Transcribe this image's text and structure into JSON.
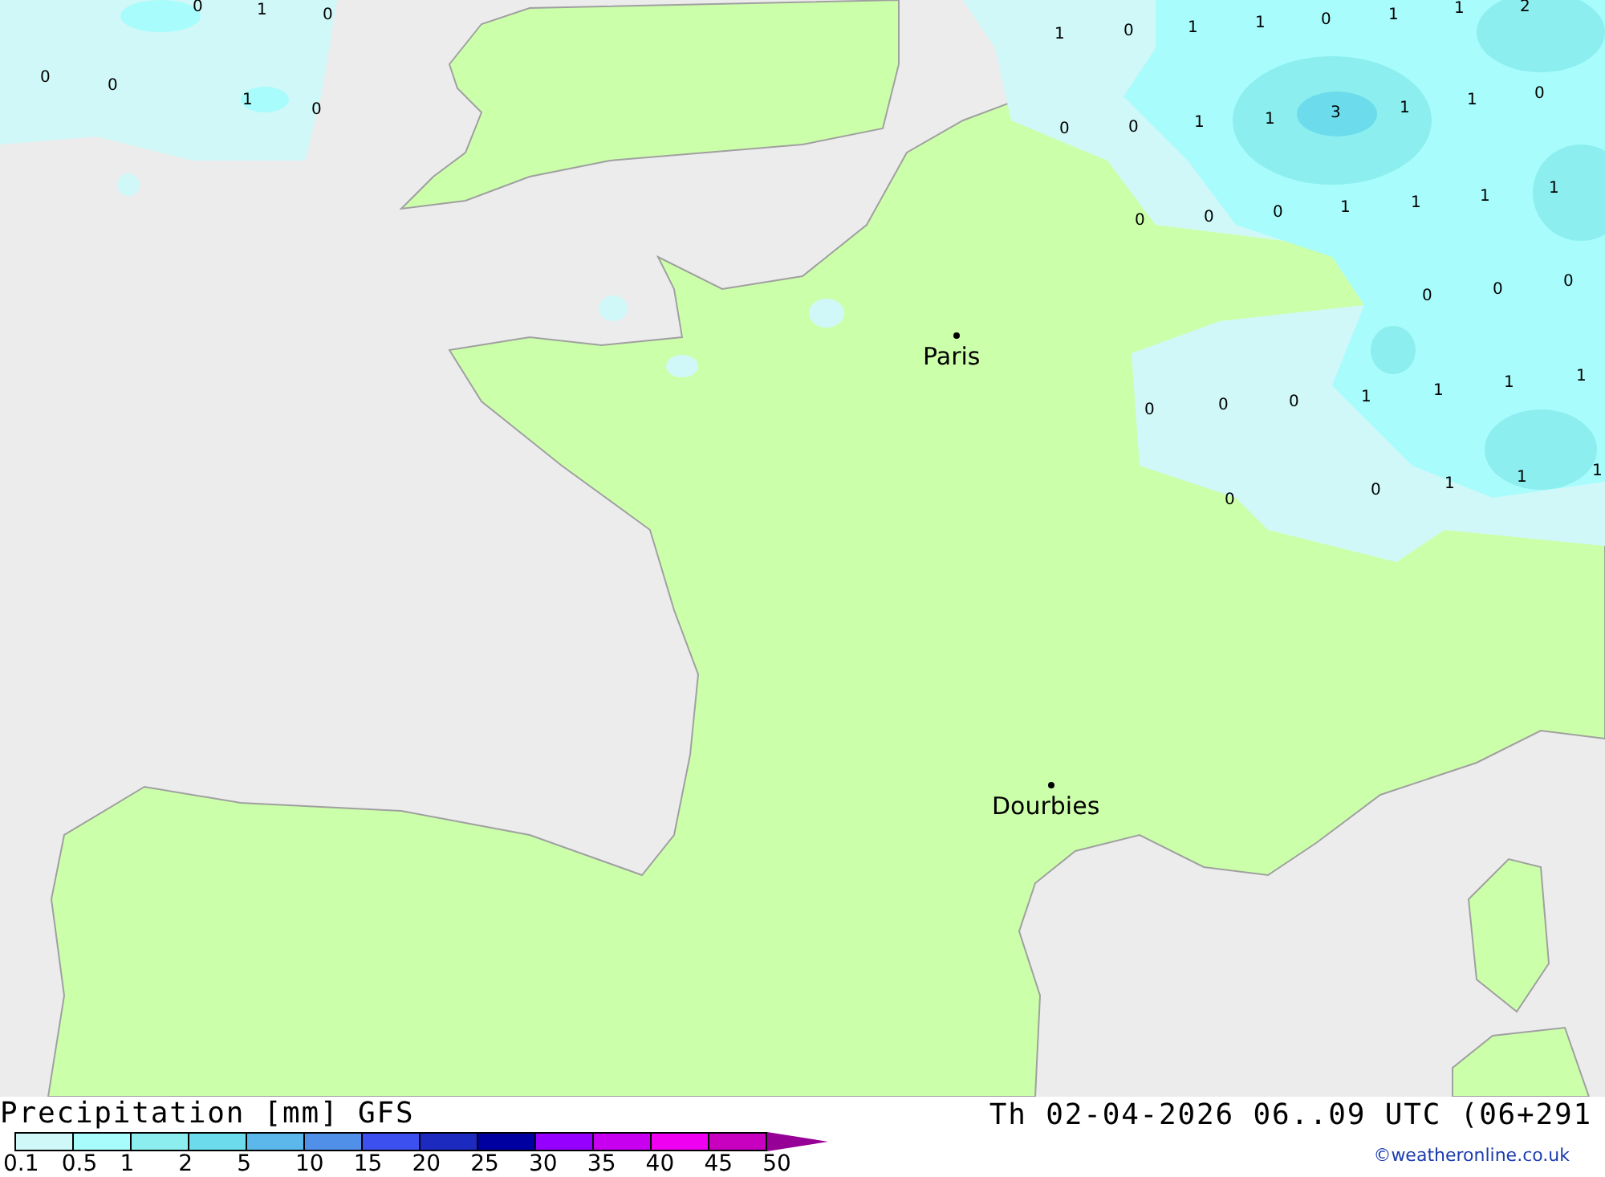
{
  "map": {
    "cities": [
      {
        "name": "Paris"
      },
      {
        "name": "Dourbies"
      }
    ],
    "values": [
      "0",
      "1",
      "0",
      "0",
      "0",
      "1",
      "0",
      "1",
      "0",
      "1",
      "1",
      "0",
      "1",
      "1",
      "2",
      "0",
      "0",
      "1",
      "1",
      "3",
      "1",
      "1",
      "0",
      "0",
      "0",
      "0",
      "1",
      "1",
      "1",
      "1",
      "0",
      "0",
      "0",
      "0",
      "0",
      "0",
      "1",
      "1",
      "1",
      "1",
      "0",
      "0",
      "1",
      "1",
      "1"
    ]
  },
  "legend": {
    "title": "Precipitation [mm] GFS",
    "classes": [
      {
        "label": "0.1",
        "color": "#d0f8f8"
      },
      {
        "label": "0.5",
        "color": "#a8fcfc"
      },
      {
        "label": "1",
        "color": "#8ceeee"
      },
      {
        "label": "2",
        "color": "#6cdcec"
      },
      {
        "label": "5",
        "color": "#5cb8ea"
      },
      {
        "label": "10",
        "color": "#5090e8"
      },
      {
        "label": "15",
        "color": "#3c50f0"
      },
      {
        "label": "20",
        "color": "#1c2ac0"
      },
      {
        "label": "25",
        "color": "#0000a0"
      },
      {
        "label": "30",
        "color": "#9600ff"
      },
      {
        "label": "35",
        "color": "#c800f0"
      },
      {
        "label": "40",
        "color": "#f000f0"
      },
      {
        "label": "45",
        "color": "#c800c0"
      },
      {
        "label": "50",
        "color": "#960096",
        "kind": "arrow"
      }
    ]
  },
  "valid_time": "Th 02-04-2026 06..09 UTC (06+291",
  "credit": "©weatheronline.co.uk"
}
